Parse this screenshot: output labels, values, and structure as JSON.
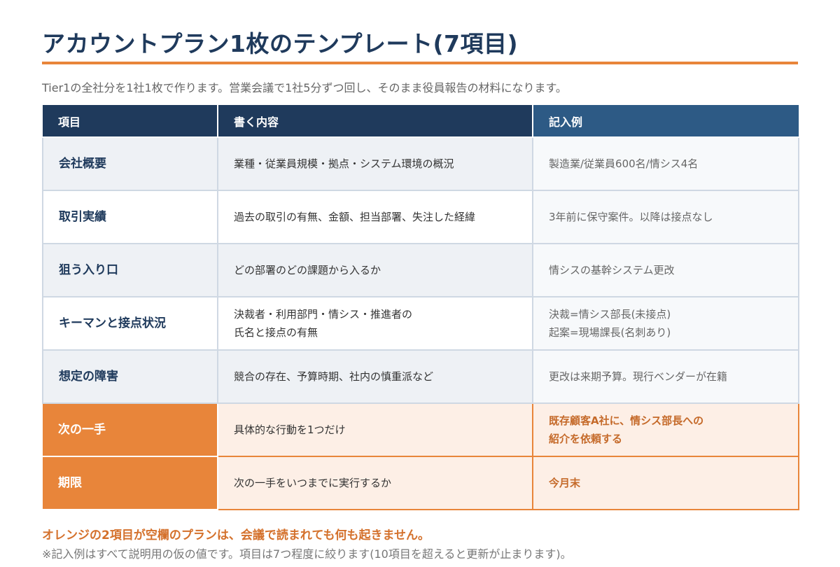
{
  "title": "アカウントプラン1枚のテンプレート(7項目)",
  "subtitle": "Tier1の全社分を1社1枚で作ります。営業会議で1社5分ずつ回し、そのまま役員報告の材料になります。",
  "table": {
    "headers": [
      "項目",
      "書く内容",
      "記入例"
    ],
    "rows": [
      {
        "item": "会社概要",
        "desc": [
          "業種・従業員規模・拠点・システム環境の概況"
        ],
        "example": [
          "製造業/従業員600名/情シス4名"
        ]
      },
      {
        "item": "取引実績",
        "desc": [
          "過去の取引の有無、金額、担当部署、失注した経緯"
        ],
        "example": [
          "3年前に保守案件。以降は接点なし"
        ]
      },
      {
        "item": "狙う入り口",
        "desc": [
          "どの部署のどの課題から入るか"
        ],
        "example": [
          "情シスの基幹システム更改"
        ]
      },
      {
        "item": "キーマンと接点状況",
        "desc": [
          "決裁者・利用部門・情シス・推進者の",
          "氏名と接点の有無"
        ],
        "example": [
          "決裁=情シス部長(未接点)",
          "起案=現場課長(名刺あり)"
        ]
      },
      {
        "item": "想定の障害",
        "desc": [
          "競合の存在、予算時期、社内の慎重派など"
        ],
        "example": [
          "更改は来期予算。現行ベンダーが在籍"
        ]
      },
      {
        "item": "次の一手",
        "desc": [
          "具体的な行動を1つだけ"
        ],
        "example": [
          "既存顧客A社に、情シス部長への",
          "紹介を依頼する"
        ]
      },
      {
        "item": "期限",
        "desc": [
          "次の一手をいつまでに実行するか"
        ],
        "example": [
          "今月末"
        ]
      }
    ]
  },
  "warning": "オレンジの2項目が空欄のプランは、会議で読まれても何も起きません。",
  "note": "※記入例はすべて説明用の仮の値です。項目は7つ程度に絞ります(10項目を超えると更新が止まります)。",
  "colors": {
    "navy": "#1f3a5c",
    "header_blue": "#2d5a85",
    "orange": "#e8853a",
    "orange_light": "#fdefe6"
  }
}
